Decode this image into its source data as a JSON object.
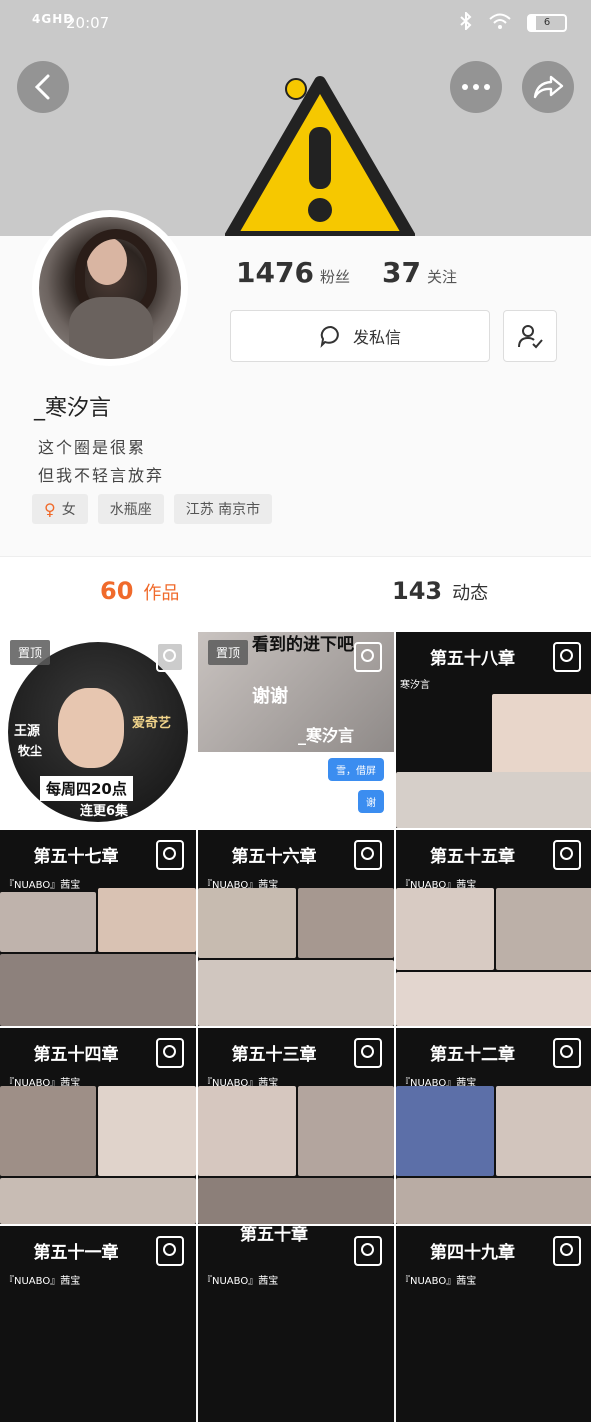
{
  "status_bar": {
    "network": "4GHD",
    "time": "20:07",
    "battery": "6"
  },
  "profile": {
    "fans_count": "1476",
    "fans_label": "粉丝",
    "following_count": "37",
    "following_label": "关注",
    "message_label": "发私信",
    "username": "_寒汐言",
    "bio_line1": "这个圈是很累",
    "bio_line2": "但我不轻言放弃",
    "tags": [
      "女",
      "水瓶座",
      "江苏 南京市"
    ]
  },
  "tabs": {
    "works_count": "60",
    "works_label": "作品",
    "moments_count": "143",
    "moments_label": "动态"
  },
  "grid": {
    "pin_label": "置顶",
    "cell1": {
      "name1": "王源",
      "name2": "牧尘",
      "banner": "每周四20点",
      "update": "连更6集",
      "brand": "爱奇艺"
    },
    "cell2": {
      "top": "看到的进下吧",
      "thanks": "谢谢",
      "author": "_寒汐言",
      "chat1": "雪，借屏",
      "chat2": "谢"
    },
    "cells": [
      {
        "chapter": "第五十八章",
        "sub": "寒汐言"
      },
      {
        "chapter": "第五十七章",
        "sub": "『NUABO』茜宝"
      },
      {
        "chapter": "第五十六章",
        "sub": "『NUABO』茜宝"
      },
      {
        "chapter": "第五十五章",
        "sub": "『NUABO』茜宝"
      },
      {
        "chapter": "第五十四章",
        "sub": "『NUABO』茜宝"
      },
      {
        "chapter": "第五十三章",
        "sub": "『NUABO』茜宝"
      },
      {
        "chapter": "第五十二章",
        "sub": "『NUABO』茜宝"
      },
      {
        "chapter": "第五十一章",
        "sub": "『NUABO』茜宝"
      },
      {
        "chapter": "第五十章",
        "sub": "『NUABO』茜宝"
      },
      {
        "chapter": "第四十九章",
        "sub": "『NUABO』茜宝"
      }
    ]
  },
  "colors": {
    "accent": "#f06a2b",
    "banner_bg": "#c9c9c9",
    "warning_yellow": "#f6c800"
  }
}
